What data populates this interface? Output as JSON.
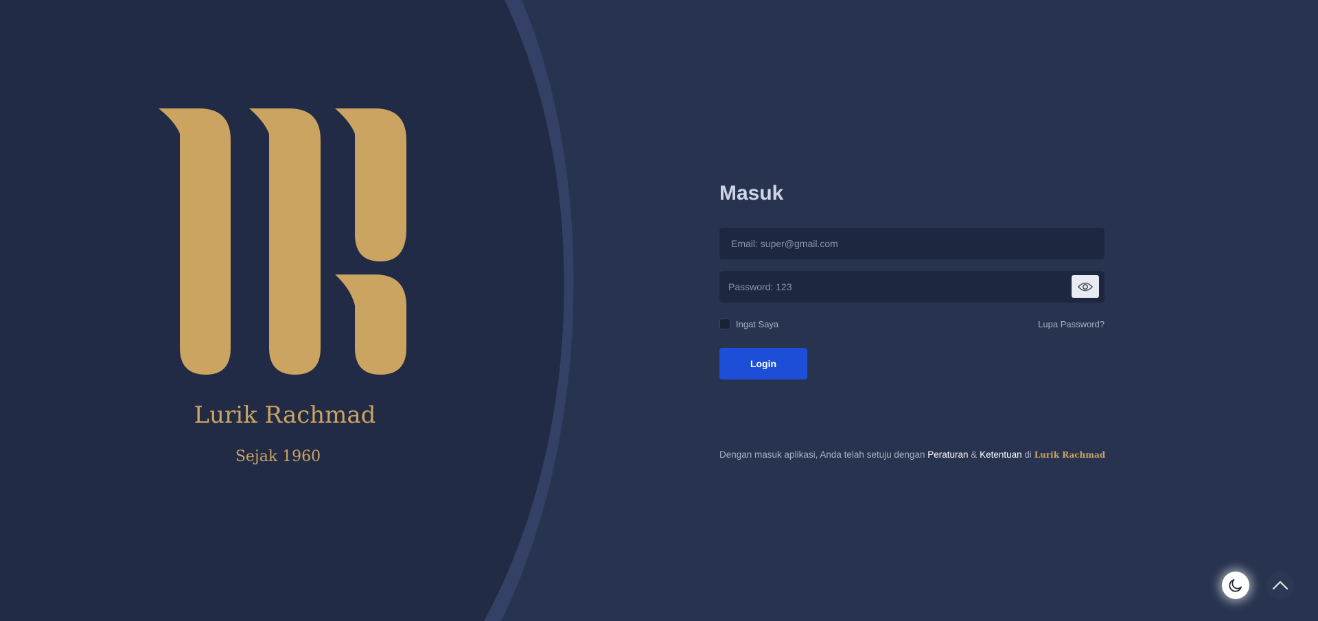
{
  "brand": {
    "name": "Lurik Rachmad",
    "since": "Sejak 1960"
  },
  "login": {
    "title": "Masuk",
    "email_placeholder": "Email: super@gmail.com",
    "password_placeholder": "Password: 123",
    "remember_label": "Ingat Saya",
    "forgot_label": "Lupa Password?",
    "submit_label": "Login"
  },
  "terms": {
    "prefix": "Dengan masuk aplikasi, Anda telah setuju dengan",
    "rules_link": "Peraturan",
    "amp": "&",
    "terms_link": "Ketentuan",
    "at": "di",
    "brand": "Lurik Rachmad"
  },
  "icons": {
    "password_toggle": "eye-icon",
    "theme_toggle": "moon-icon",
    "scroll_top": "chevron-up-icon"
  },
  "colors": {
    "background": "#28344f",
    "left_panel": "#222b45",
    "brand_gold": "#cba462",
    "primary": "#1d4ed8",
    "input_bg": "#1e2740"
  }
}
